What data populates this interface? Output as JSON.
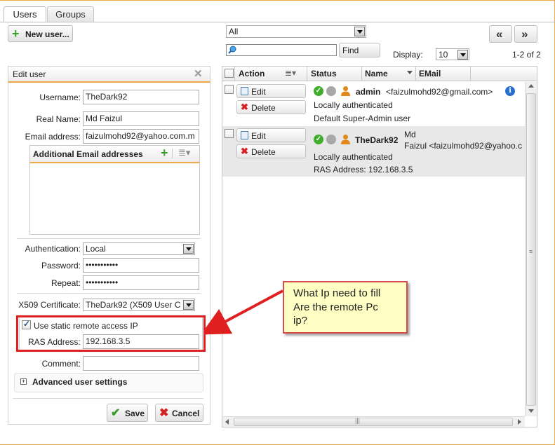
{
  "tabs": [
    {
      "label": "Users"
    },
    {
      "label": "Groups"
    }
  ],
  "toolbar": {
    "new_user_label": "New user...",
    "filter_select": "All",
    "search_value": "",
    "find_label": "Find",
    "display_label": "Display:",
    "display_value": "10",
    "page_range": "1-2 of 2",
    "prev_label": "«",
    "next_label": "»"
  },
  "edit_user": {
    "title": "Edit user",
    "username_label": "Username:",
    "username_value": "TheDark92",
    "realname_label": "Real Name:",
    "realname_value": "Md Faizul",
    "email_label": "Email address:",
    "email_value": "faizulmohd92@yahoo.com.m",
    "additional_emails_label": "Additional Email addresses",
    "auth_label": "Authentication:",
    "auth_value": "Local",
    "password_label": "Password:",
    "password_value": "•••••••••••",
    "repeat_label": "Repeat:",
    "repeat_value": "•••••••••••",
    "x509_label": "X509 Certificate:",
    "x509_value": "TheDark92 (X509 User C",
    "static_ip_label": "Use static remote access IP",
    "ras_label": "RAS Address:",
    "ras_value": "192.168.3.5",
    "comment_label": "Comment:",
    "comment_value": "",
    "advanced_label": "Advanced user settings",
    "save_label": "Save",
    "cancel_label": "Cancel"
  },
  "grid": {
    "columns": [
      "Action",
      "Status",
      "Name",
      "EMail"
    ],
    "edit_label": "Edit",
    "delete_label": "Delete",
    "rows": [
      {
        "name": "admin",
        "email": "<faizulmohd92@gmail.com>",
        "line1": "Locally authenticated",
        "line2": "Default Super-Admin user"
      },
      {
        "name": "TheDark92",
        "realname_part": "Md",
        "email": "Faizul <faizulmohd92@yahoo.c",
        "line1": "Locally authenticated",
        "line2": "RAS Address: 192.168.3.5"
      }
    ]
  },
  "callout": {
    "line1": "What Ip need to fill",
    "line2": "Are the remote Pc",
    "line3": "ip?"
  },
  "colors": {
    "accent_orange": "#f0a84a",
    "annotation_red": "#e02020",
    "callout_yellow": "#ffffc4",
    "status_green": "#3fae2a",
    "user_orange": "#e08a1e",
    "info_blue": "#2a6fd0"
  }
}
